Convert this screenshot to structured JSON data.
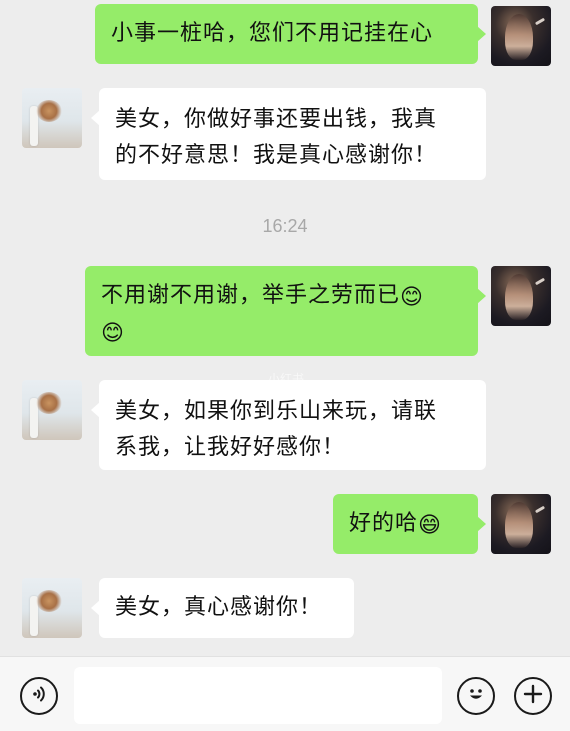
{
  "messages": [
    {
      "side": "me",
      "text": "小事一桩哈，您们不用记挂在心"
    },
    {
      "side": "other",
      "line1": "美女，你做好事还要出钱，我真",
      "line2": "的不好意思！我是真心感谢你！"
    },
    {
      "side": "me",
      "line1": "不用谢不用谢，举手之劳而已",
      "emoji1": "😊",
      "emoji2": "😊"
    },
    {
      "side": "other",
      "line1": "美女，如果你到乐山来玩，请联",
      "line2": "系我，让我好好感你！"
    },
    {
      "side": "me",
      "text": "好的哈",
      "emoji": "😄"
    },
    {
      "side": "other",
      "text": "美女，真心感谢你！"
    }
  ],
  "timestamp": "16:24",
  "watermark": "小红书",
  "input_bar": {
    "voice_icon": "voice-icon",
    "emoji_icon": "emoji-icon",
    "plus_icon": "plus-icon",
    "placeholder": ""
  },
  "colors": {
    "background": "#ededed",
    "my_bubble": "#95ec69",
    "their_bubble": "#ffffff",
    "timestamp": "#a8a8a8"
  }
}
